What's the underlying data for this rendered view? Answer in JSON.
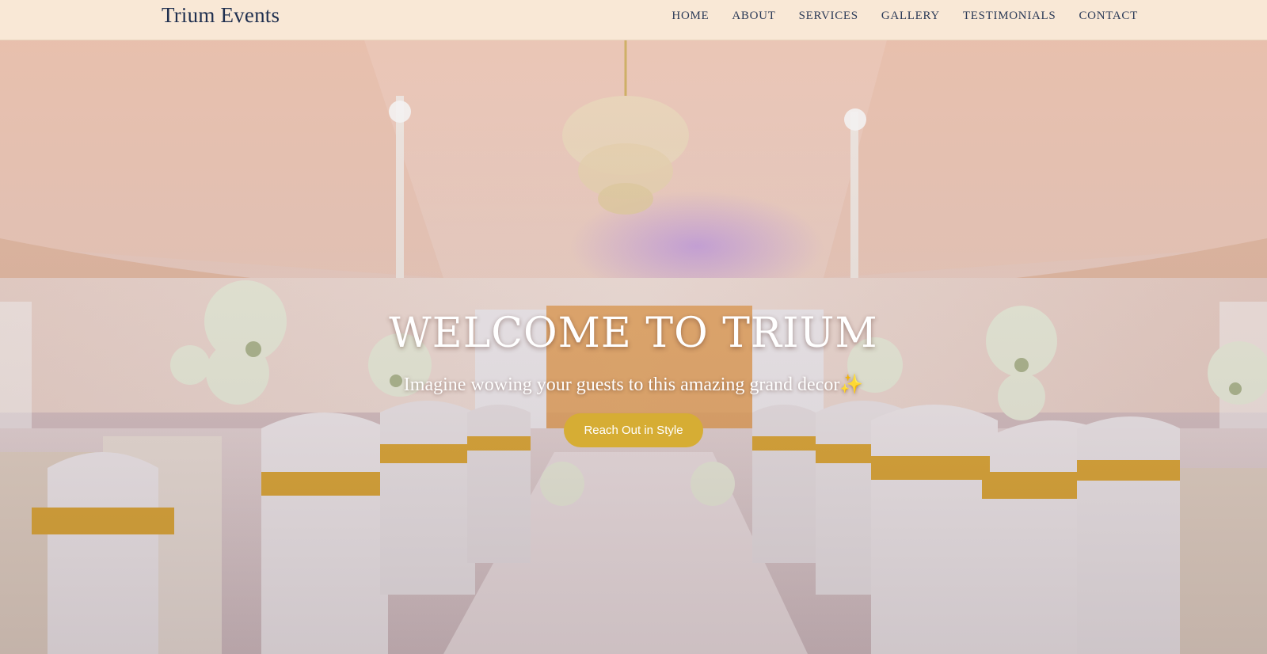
{
  "brand": {
    "name": "Trium Events"
  },
  "nav": {
    "items": [
      {
        "label": "HOME"
      },
      {
        "label": "ABOUT"
      },
      {
        "label": "SERVICES"
      },
      {
        "label": "GALLERY"
      },
      {
        "label": "TESTIMONIALS"
      },
      {
        "label": "CONTACT"
      }
    ]
  },
  "hero": {
    "title": "WELCOME TO TRIUM",
    "subtitle": "Imagine wowing your guests to this amazing grand decor✨",
    "cta_label": "Reach Out in Style",
    "background": "wedding-hall-decor-image"
  },
  "colors": {
    "navbar_bg": "#f9e8d6",
    "brand_text": "#1f2f4f",
    "nav_text": "#2b3a57",
    "cta_bg": "#d6ad34",
    "accent_sash": "#e2ad3c"
  }
}
